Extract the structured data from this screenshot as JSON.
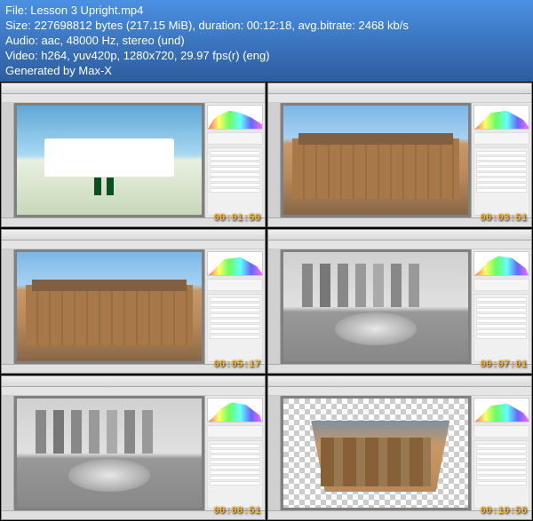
{
  "info": {
    "line1_label": "File:",
    "line1_value": "Lesson 3 Upright.mp4",
    "line2_label": "Size:",
    "line2_value": "227698812 bytes (217.15 MiB), duration: 00:12:18, avg.bitrate: 2468 kb/s",
    "line3_label": "Audio:",
    "line3_value": "aac, 48000 Hz, stereo (und)",
    "line4_label": "Video:",
    "line4_value": "h264, yuv420p, 1280x720, 29.97 fps(r) (eng)",
    "line5": "Generated by Max-X"
  },
  "thumbs": [
    {
      "timestamp": "00:01:50",
      "imgClass": "img-gas",
      "histo": ""
    },
    {
      "timestamp": "00:03:51",
      "imgClass": "img-palace",
      "histo": "histo-r"
    },
    {
      "timestamp": "00:05:17",
      "imgClass": "img-palace",
      "histo": "histo-r"
    },
    {
      "timestamp": "00:07:01",
      "imgClass": "img-bean",
      "histo": "histo-b"
    },
    {
      "timestamp": "00:08:51",
      "imgClass": "img-bean",
      "histo": "histo-b"
    },
    {
      "timestamp": "00:10:56",
      "imgClass": "img-crop",
      "histo": "histo-r"
    }
  ]
}
